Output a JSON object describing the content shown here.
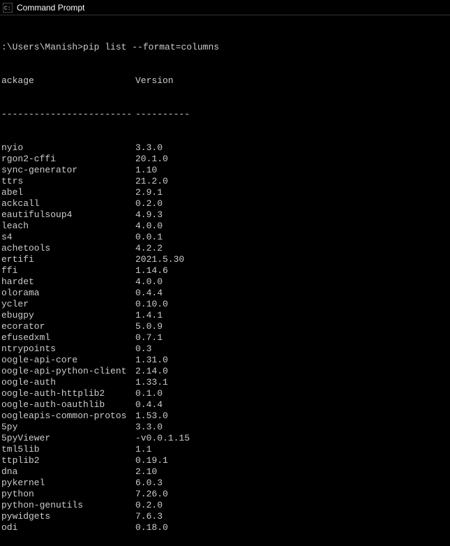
{
  "window": {
    "title": "Command Prompt"
  },
  "prompt": {
    "path": ":\\Users\\Manish>",
    "command": "pip list --format=columns"
  },
  "header": {
    "col1": "ackage",
    "col2": "Version",
    "sep1": "------------------------",
    "sep2": "----------"
  },
  "packages": [
    {
      "name": "nyio",
      "version": "3.3.0"
    },
    {
      "name": "rgon2-cffi",
      "version": "20.1.0"
    },
    {
      "name": "sync-generator",
      "version": "1.10"
    },
    {
      "name": "ttrs",
      "version": "21.2.0"
    },
    {
      "name": "abel",
      "version": "2.9.1"
    },
    {
      "name": "ackcall",
      "version": "0.2.0"
    },
    {
      "name": "eautifulsoup4",
      "version": "4.9.3"
    },
    {
      "name": "leach",
      "version": "4.0.0"
    },
    {
      "name": "s4",
      "version": "0.0.1"
    },
    {
      "name": "achetools",
      "version": "4.2.2"
    },
    {
      "name": "ertifi",
      "version": "2021.5.30"
    },
    {
      "name": "ffi",
      "version": "1.14.6"
    },
    {
      "name": "hardet",
      "version": "4.0.0"
    },
    {
      "name": "olorama",
      "version": "0.4.4"
    },
    {
      "name": "ycler",
      "version": "0.10.0"
    },
    {
      "name": "ebugpy",
      "version": "1.4.1"
    },
    {
      "name": "ecorator",
      "version": "5.0.9"
    },
    {
      "name": "efusedxml",
      "version": "0.7.1"
    },
    {
      "name": "ntrypoints",
      "version": "0.3"
    },
    {
      "name": "oogle-api-core",
      "version": "1.31.0"
    },
    {
      "name": "oogle-api-python-client",
      "version": "2.14.0"
    },
    {
      "name": "oogle-auth",
      "version": "1.33.1"
    },
    {
      "name": "oogle-auth-httplib2",
      "version": "0.1.0"
    },
    {
      "name": "oogle-auth-oauthlib",
      "version": "0.4.4"
    },
    {
      "name": "oogleapis-common-protos",
      "version": "1.53.0"
    },
    {
      "name": "5py",
      "version": "3.3.0"
    },
    {
      "name": "5pyViewer",
      "version": "-v0.0.1.15"
    },
    {
      "name": "tml5lib",
      "version": "1.1"
    },
    {
      "name": "ttplib2",
      "version": "0.19.1"
    },
    {
      "name": "dna",
      "version": "2.10"
    },
    {
      "name": "pykernel",
      "version": "6.0.3"
    },
    {
      "name": "python",
      "version": "7.26.0"
    },
    {
      "name": "python-genutils",
      "version": "0.2.0"
    },
    {
      "name": "pywidgets",
      "version": "7.6.3"
    },
    {
      "name": "odi",
      "version": "0.18.0"
    }
  ]
}
